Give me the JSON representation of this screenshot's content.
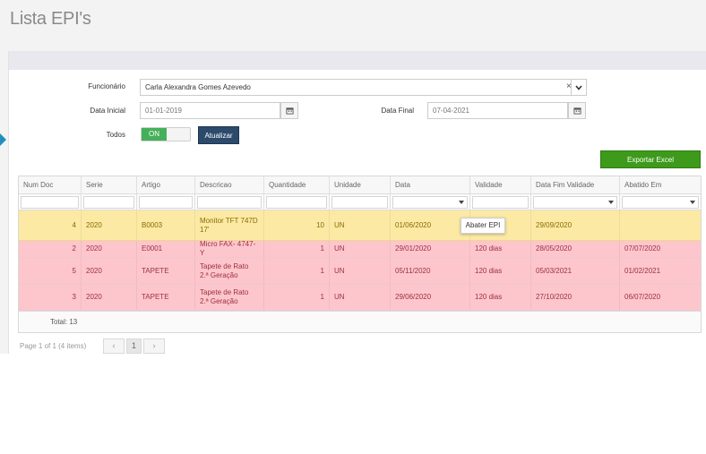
{
  "page": {
    "title": "Lista EPI's"
  },
  "form": {
    "funcionario_label": "Funcionário",
    "funcionario_value": "Carla Alexandra Gomes Azevedo",
    "clear_symbol": "×",
    "dropdown_symbol": "⌄",
    "data_inicial_label": "Data Inicial",
    "data_inicial_value": "01-01-2019",
    "data_final_label": "Data Final",
    "data_final_value": "07-04-2021",
    "calendar_icon": "calendar-icon",
    "todos_label": "Todos",
    "toggle_on_label": "ON",
    "atualizar_label": "Atualizar"
  },
  "toolbar": {
    "export_label": "Exportar Excel"
  },
  "grid": {
    "columns": [
      "Num Doc",
      "Serie",
      "Artigo",
      "Descricao",
      "Quantidade",
      "Unidade",
      "Data",
      "Validade",
      "Data Fim Validade",
      "Abatido Em"
    ],
    "rows": [
      {
        "num_doc": "4",
        "serie": "2020",
        "artigo": "B0003",
        "descricao": "Monitor TFT 747D 17'",
        "quantidade": "10",
        "unidade": "UN",
        "data": "01/06/2020",
        "validade": "",
        "data_fim": "29/09/2020",
        "abatido": "",
        "status": "yellow"
      },
      {
        "num_doc": "2",
        "serie": "2020",
        "artigo": "E0001",
        "descricao": "Micro FAX- 4747-Y",
        "quantidade": "1",
        "unidade": "UN",
        "data": "29/01/2020",
        "validade": "120 dias",
        "data_fim": "28/05/2020",
        "abatido": "07/07/2020",
        "status": "pink"
      },
      {
        "num_doc": "5",
        "serie": "2020",
        "artigo": "TAPETE",
        "descricao": "Tapete de Rato 2.ª Geração",
        "quantidade": "1",
        "unidade": "UN",
        "data": "05/11/2020",
        "validade": "120 dias",
        "data_fim": "05/03/2021",
        "abatido": "01/02/2021",
        "status": "pink"
      },
      {
        "num_doc": "3",
        "serie": "2020",
        "artigo": "TAPETE",
        "descricao": "Tapete de Rato 2.ª Geração",
        "quantidade": "1",
        "unidade": "UN",
        "data": "29/06/2020",
        "validade": "120 dias",
        "data_fim": "27/10/2020",
        "abatido": "06/07/2020",
        "status": "pink"
      }
    ],
    "total": "Total: 13",
    "row_colors": {
      "yellow": "#fbe9a4",
      "pink": "#fcc6cc"
    }
  },
  "tooltip": {
    "text": "Abater EPI"
  },
  "pager": {
    "info": "Page 1 of 1 (4 items)",
    "prev": "‹",
    "current": "1",
    "next": "›"
  },
  "colors": {
    "export_button": "#3e9a1b",
    "update_button": "#2c4a6b",
    "toggle_on": "#45b05a"
  }
}
